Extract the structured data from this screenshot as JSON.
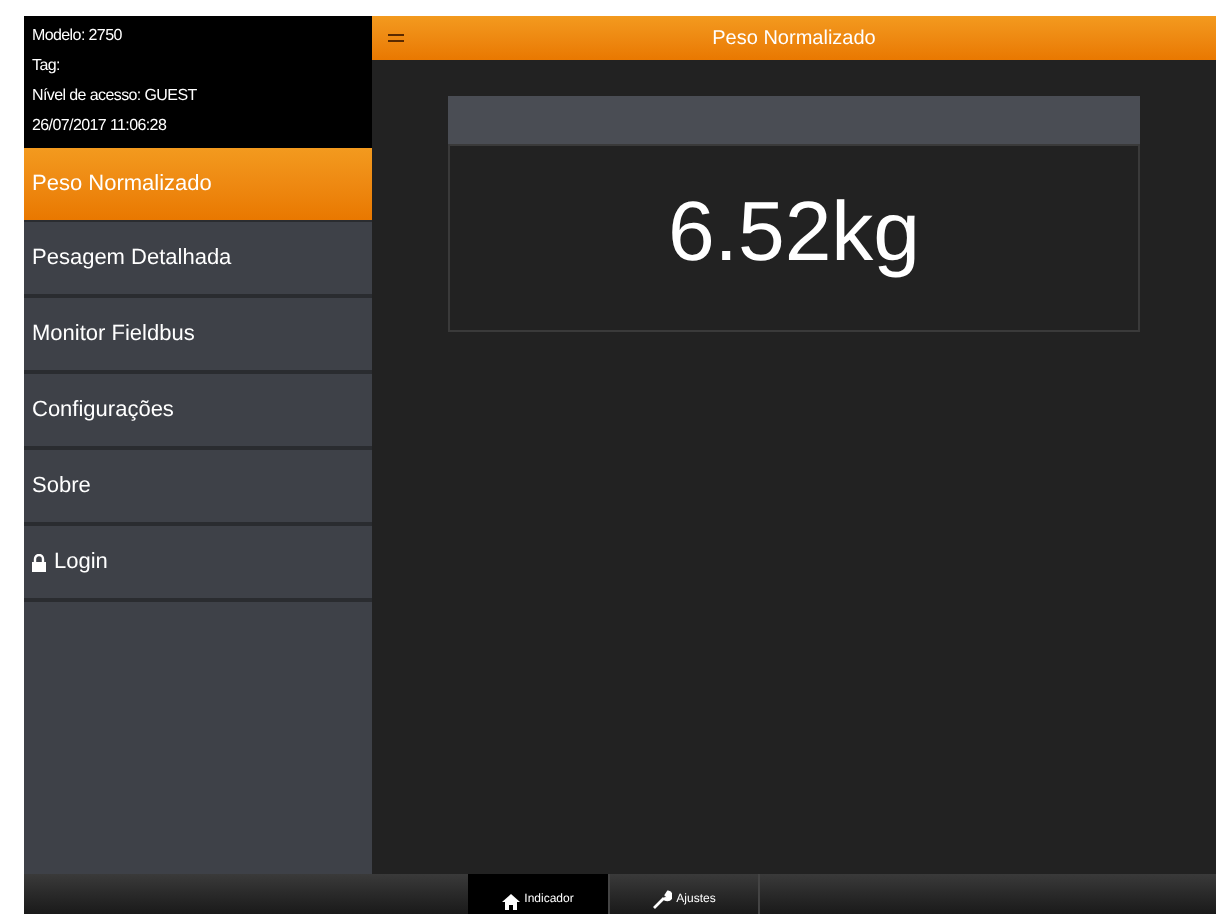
{
  "info": {
    "model": "Modelo: 2750",
    "tag": "Tag:",
    "access": "Nível de acesso: GUEST",
    "datetime": "26/07/2017 11:06:28"
  },
  "menu": [
    {
      "label": "Peso Normalizado",
      "selected": true,
      "kind": "plain"
    },
    {
      "label": "Pesagem Detalhada",
      "selected": false,
      "kind": "plain"
    },
    {
      "label": "Monitor Fieldbus",
      "selected": false,
      "kind": "plain"
    },
    {
      "label": "Configurações",
      "selected": false,
      "kind": "plain"
    },
    {
      "label": "Sobre",
      "selected": false,
      "kind": "plain"
    },
    {
      "label": "Login",
      "selected": false,
      "kind": "lock"
    }
  ],
  "header": {
    "title": "Peso Normalizado"
  },
  "weight": {
    "value": "6.52kg"
  },
  "bottom_tabs": [
    {
      "label": "Indicador",
      "selected": true,
      "kind": "home"
    },
    {
      "label": "Ajustes",
      "selected": false,
      "kind": "wrench"
    }
  ]
}
